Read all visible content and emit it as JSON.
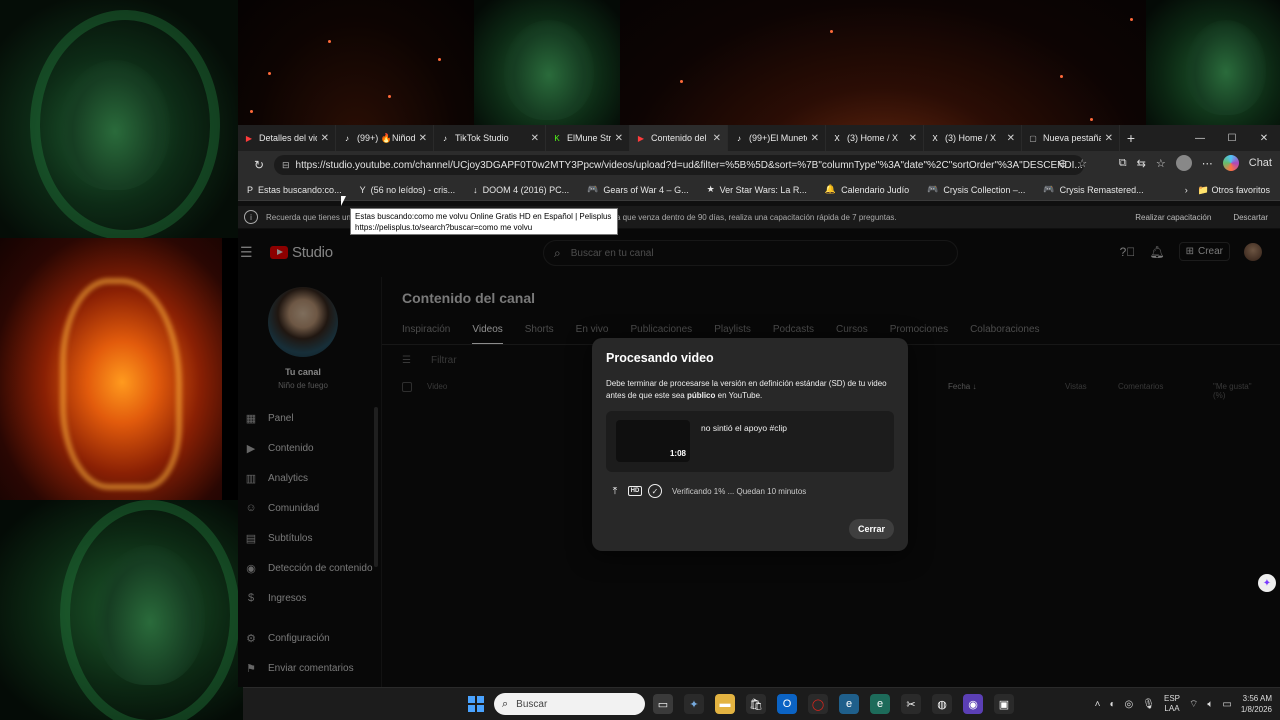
{
  "browser": {
    "tabs": [
      {
        "label": "Detalles del vide",
        "icon": "youtube-icon",
        "active": false
      },
      {
        "label": "(99+) 🔥Niñode",
        "icon": "tiktok-icon",
        "active": false
      },
      {
        "label": "TikTok Studio",
        "icon": "tiktok-icon",
        "active": false
      },
      {
        "label": "ElMune Str",
        "icon": "kick-icon",
        "active": false
      },
      {
        "label": "Contenido del c",
        "icon": "youtube-icon",
        "active": true
      },
      {
        "label": "(99+)El Muneto",
        "icon": "tiktok-icon",
        "active": false
      },
      {
        "label": "(3) Home / X",
        "icon": "x-icon",
        "active": false
      },
      {
        "label": "(3) Home / X",
        "icon": "x-icon",
        "active": false
      },
      {
        "label": "Nueva pestaña",
        "icon": "new-tab-icon",
        "active": false
      }
    ],
    "url": "https://studio.youtube.com/channel/UCjoy3DGAPF0T0w2MTY3Ppcw/videos/upload?d=ud&filter=%5B%5D&sort=%7B\"columnType\"%3A\"date\"%2C\"sortOrder\"%3A\"DESCENDI...",
    "chat_label": "Chat",
    "bookmarks": [
      {
        "label": "Estas buscando:co...",
        "icon": "P"
      },
      {
        "label": "(56 no leídos) - cris...",
        "icon": "Y"
      },
      {
        "label": "DOOM 4 (2016) PC...",
        "icon": "↓"
      },
      {
        "label": "Gears of War 4 – G...",
        "icon": "🎮"
      },
      {
        "label": "Ver Star Wars: La R...",
        "icon": "★"
      },
      {
        "label": "Calendario Judío",
        "icon": "🔔"
      },
      {
        "label": "Crysis Collection –...",
        "icon": "🎮"
      },
      {
        "label": "Crysis Remastered...",
        "icon": "🎮"
      }
    ],
    "other_favorites": "Otros favoritos",
    "infobar": {
      "text": "Recuerda que tienes una",
      "text2": "a que venza dentro de 90 días, realiza una capacitación rápida de 7 preguntas.",
      "action1": "Realizar capacitación",
      "action2": "Descartar"
    }
  },
  "tooltip": {
    "line1": "Estas buscando:como me volvu Online Gratis HD en Español | Pelisplus",
    "line2": "https://pelisplus.to/search?buscar=como me volvu"
  },
  "studio": {
    "logo": "Studio",
    "search_placeholder": "Buscar en tu canal",
    "create_label": "Crear",
    "channel_name": "Tu canal",
    "channel_sub": "Niño de fuego",
    "nav": [
      {
        "label": "Panel",
        "icon": "dashboard-icon"
      },
      {
        "label": "Contenido",
        "icon": "content-icon"
      },
      {
        "label": "Analytics",
        "icon": "analytics-icon"
      },
      {
        "label": "Comunidad",
        "icon": "community-icon"
      },
      {
        "label": "Subtítulos",
        "icon": "subtitles-icon"
      },
      {
        "label": "Detección de contenido",
        "icon": "detection-icon"
      },
      {
        "label": "Ingresos",
        "icon": "earnings-icon"
      },
      {
        "label": "Configuración",
        "icon": "settings-icon"
      },
      {
        "label": "Enviar comentarios",
        "icon": "feedback-icon"
      }
    ],
    "page_title": "Contenido del canal",
    "tabs": [
      "Inspiración",
      "Videos",
      "Shorts",
      "En vivo",
      "Publicaciones",
      "Playlists",
      "Podcasts",
      "Cursos",
      "Promociones",
      "Colaboraciones"
    ],
    "active_tab": "Videos",
    "filter_label": "Filtrar",
    "table_headers": {
      "video": "Video",
      "date": "Fecha ↓",
      "views": "Vistas",
      "comments": "Comentarios",
      "likes": "\"Me gusta\" (%)"
    }
  },
  "dialog": {
    "title": "Procesando video",
    "body_pre": "Debe terminar de procesarse la versión en definición estándar (SD) de tu video antes de que este sea ",
    "body_bold": "público",
    "body_post": " en YouTube.",
    "video_title": "no sintió el apoyo #clip",
    "duration": "1:08",
    "status": "Verificando 1% ... Quedan 10 minutos",
    "close_label": "Cerrar",
    "hd_label": "HD"
  },
  "taskbar": {
    "search_placeholder": "Buscar",
    "lang_line1": "ESP",
    "lang_line2": "LAA",
    "time": "3:56 AM",
    "date": "1/8/2026"
  }
}
